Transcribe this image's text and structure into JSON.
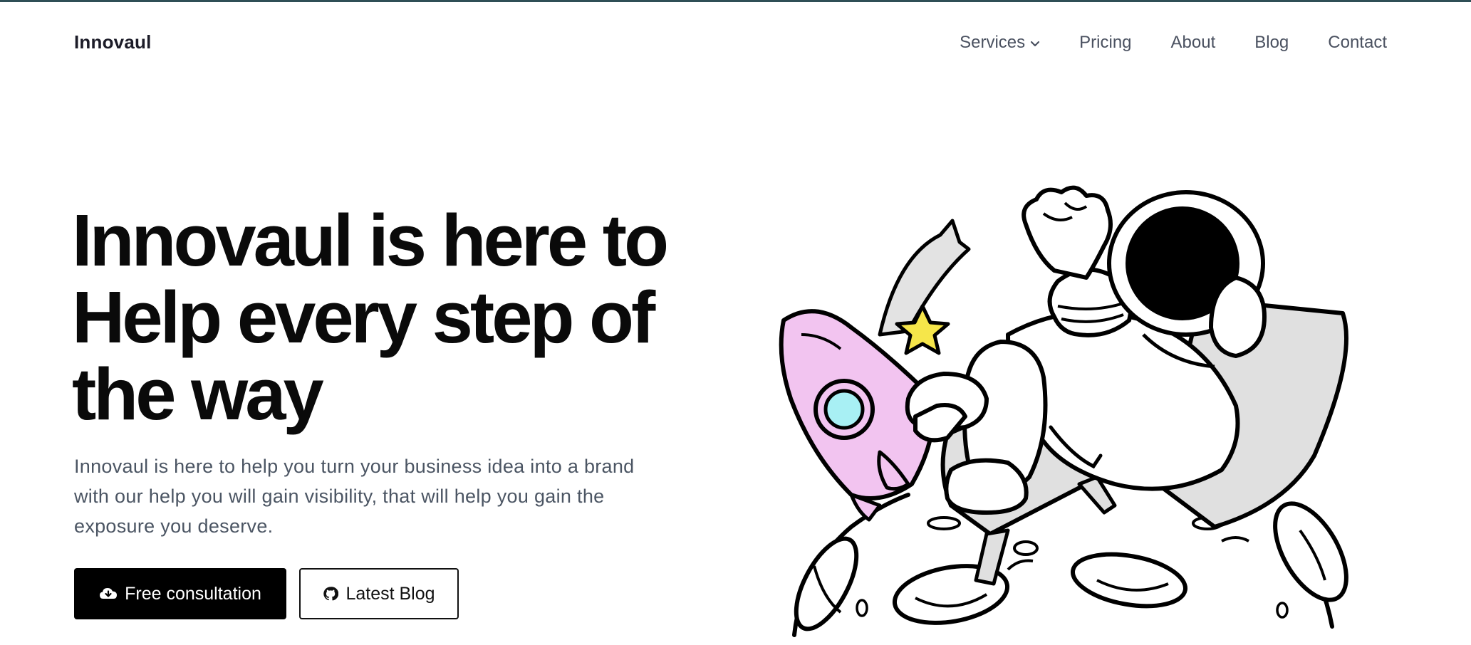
{
  "header": {
    "brand": "Innovaul",
    "nav": [
      {
        "label": "Services",
        "has_dropdown": true
      },
      {
        "label": "Pricing"
      },
      {
        "label": "About"
      },
      {
        "label": "Blog"
      },
      {
        "label": "Contact"
      }
    ]
  },
  "hero": {
    "title_lines": [
      "Innovaul is here to",
      "Help every step of",
      "the way"
    ],
    "description": "Innovaul is here to help you turn your business idea into a brand with our help you will gain visibility, that will help you gain the exposure you deserve.",
    "primary_button": {
      "label": "Free consultation",
      "icon": "cloud-download-icon"
    },
    "secondary_button": {
      "label": "Latest Blog",
      "icon": "github-icon"
    }
  },
  "colors": {
    "text_dark": "#0a0a0a",
    "text_muted": "#4b5563",
    "nav_text": "#4a5160",
    "primary_button_bg": "#000000",
    "rocket_pink": "#f2c4f0",
    "rocket_window": "#a8f0f4",
    "star_yellow": "#f6e64a",
    "visor_black": "#000000",
    "chair_gray": "#e0e0e0"
  }
}
